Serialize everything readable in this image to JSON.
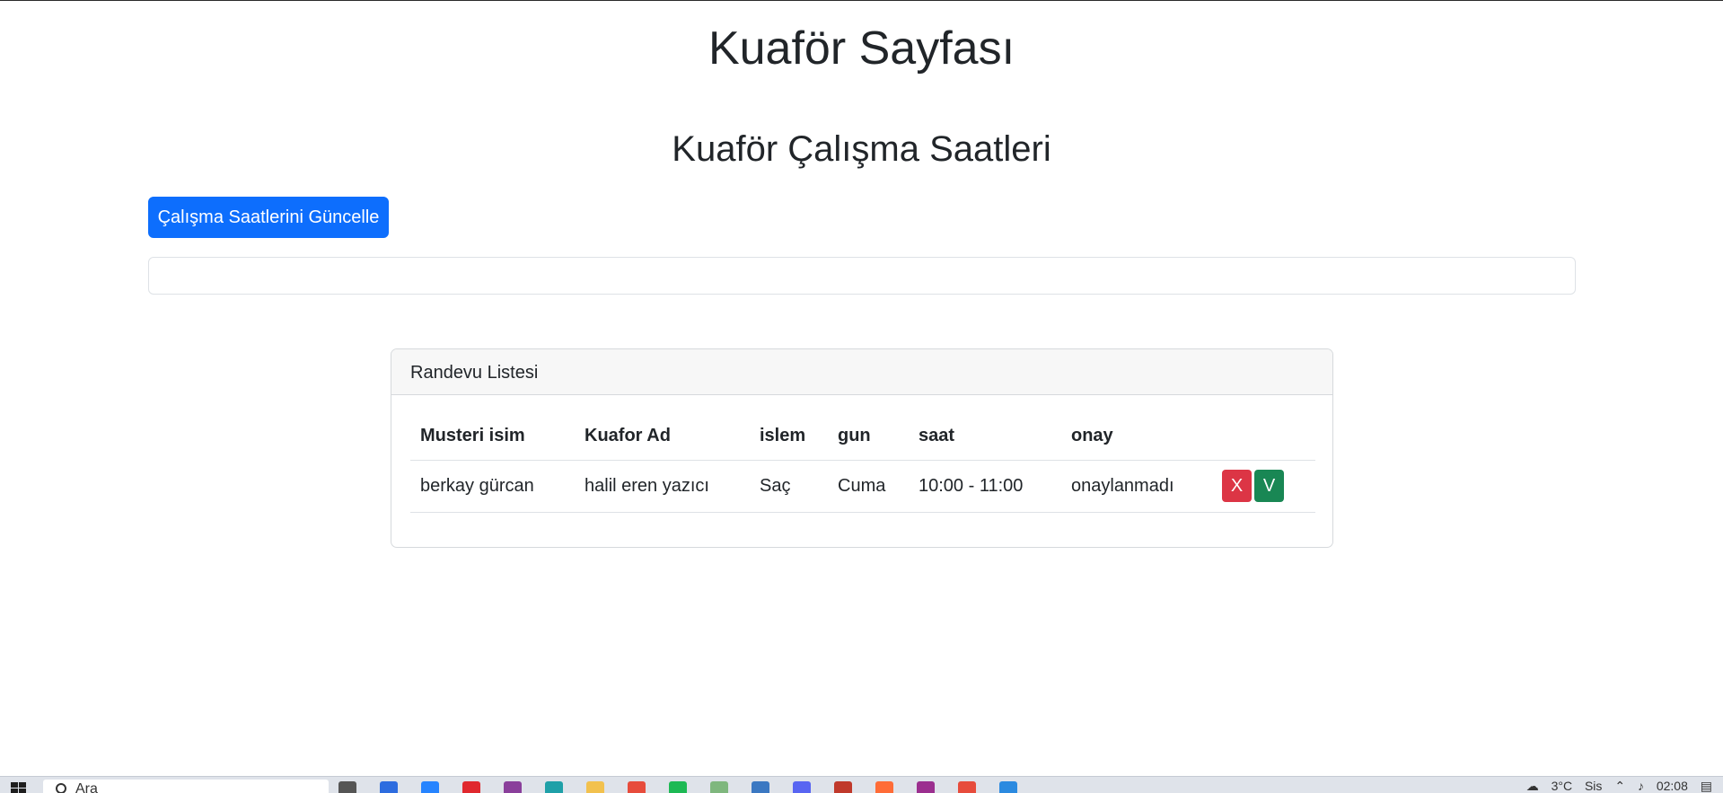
{
  "page": {
    "title": "Kuaför Sayfası",
    "section_title": "Kuaför Çalışma Saatleri",
    "update_button": "Çalışma Saatlerini Güncelle"
  },
  "appointments": {
    "card_title": "Randevu Listesi",
    "columns": [
      "Musteri isim",
      "Kuafor Ad",
      "islem",
      "gun",
      "saat",
      "onay"
    ],
    "rows": [
      {
        "customer": "berkay gürcan",
        "hairdresser": "halil eren yazıcı",
        "service": "Saç",
        "day": "Cuma",
        "time": "10:00 - 11:00",
        "status": "onaylanmadı",
        "reject_label": "X",
        "approve_label": "V"
      }
    ],
    "colors": {
      "reject": "#dc3545",
      "approve": "#198754",
      "primary": "#0d6efd"
    }
  },
  "taskbar": {
    "search_placeholder": "Ara",
    "weather": "3°C",
    "weather_text": "Sis",
    "time": "02:08",
    "pinned_icons": [
      "widgets-icon",
      "task-view-icon",
      "mail-icon",
      "jira-icon",
      "opera-icon",
      "app-icon",
      "edge-icon",
      "folder-icon",
      "chrome-icon",
      "spotify-icon",
      "notepad-icon",
      "app-icon",
      "discord-icon",
      "app-icon",
      "postman-icon",
      "app-icon",
      "chrome-icon",
      "vscode-icon"
    ]
  }
}
